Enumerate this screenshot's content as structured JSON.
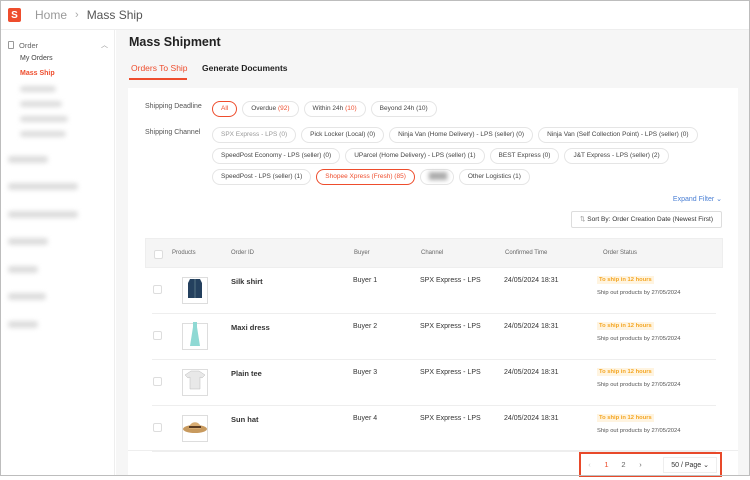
{
  "header": {
    "home": "Home",
    "current": "Mass Ship"
  },
  "sidebar": {
    "section": "Order",
    "items": [
      {
        "label": "My Orders"
      },
      {
        "label": "Mass Ship"
      }
    ]
  },
  "page": {
    "title": "Mass Shipment",
    "tabs": [
      "Orders To Ship",
      "Generate Documents"
    ]
  },
  "filters": {
    "deadline_label": "Shipping Deadline",
    "deadline": [
      {
        "label": "All",
        "count": ""
      },
      {
        "label": "Overdue",
        "count": "(92)"
      },
      {
        "label": "Within 24h",
        "count": "(10)"
      },
      {
        "label": "Beyond 24h (10)",
        "count": ""
      }
    ],
    "channel_label": "Shipping Channel",
    "channels": [
      "SPX Express - LPS (0)",
      "Pick Locker (Local) (0)",
      "Ninja Van (Home Delivery) - LPS (seller) (0)",
      "Ninja Van (Self Collection Point) - LPS (seller) (0)",
      "SpeedPost Economy - LPS (seller) (0)",
      "UParcel (Home Delivery) - LPS (seller) (1)",
      "BEST Express (0)",
      "J&T Express - LPS (seller) (2)",
      "SpeedPost - LPS (seller) (1)",
      "Shopee Xpress (Fresh) (85)",
      "Other Logistics (1)"
    ],
    "expand": "Expand Filter",
    "sort": "Sort By: Order Creation Date (Newest First)"
  },
  "table": {
    "headers": [
      "Products",
      "Order ID",
      "Buyer",
      "Channel",
      "Confirmed Time",
      "Order Status"
    ],
    "rows": [
      {
        "name": "Silk shirt",
        "buyer": "Buyer 1",
        "channel": "SPX Express - LPS",
        "time": "24/05/2024 18:31",
        "status": "To ship in 12 hours",
        "shipby": "Ship out products by 27/05/2024"
      },
      {
        "name": "Maxi dress",
        "buyer": "Buyer 2",
        "channel": "SPX Express - LPS",
        "time": "24/05/2024 18:31",
        "status": "To ship in 12 hours",
        "shipby": "Ship out products by 27/05/2024"
      },
      {
        "name": "Plain tee",
        "buyer": "Buyer 3",
        "channel": "SPX Express - LPS",
        "time": "24/05/2024 18:31",
        "status": "To ship in 12 hours",
        "shipby": "Ship out products by 27/05/2024"
      },
      {
        "name": "Sun hat",
        "buyer": "Buyer 4",
        "channel": "SPX Express - LPS",
        "time": "24/05/2024 18:31",
        "status": "To ship in 12 hours",
        "shipby": "Ship out products by 27/05/2024"
      }
    ]
  },
  "pagination": {
    "prev": "‹",
    "pages": [
      "1",
      "2"
    ],
    "next": "›",
    "per_page": "50 / Page"
  },
  "colors": {
    "accent": "#ee4d2d",
    "link": "#4a7fd4",
    "badge": "#f4a623"
  }
}
